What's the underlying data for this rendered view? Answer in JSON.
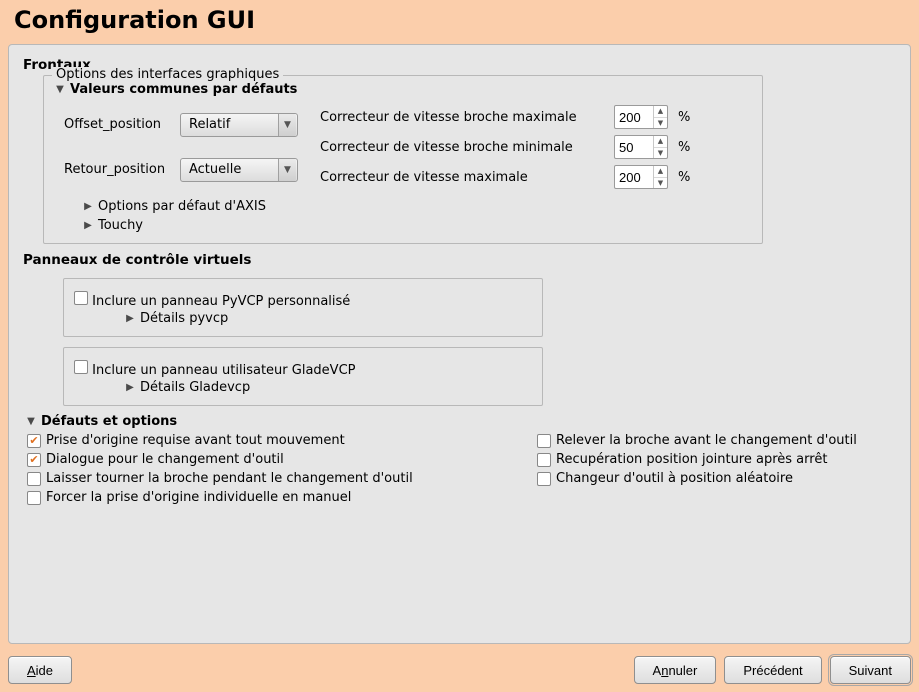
{
  "header": {
    "title": "Configuration GUI"
  },
  "frontaux": {
    "heading": "Frontaux",
    "gui_options": {
      "legend": "Options des interfaces graphiques",
      "common": {
        "title": "Valeurs communes par défauts",
        "offset_label": "Offset_position",
        "offset_value": "Relatif",
        "retour_label": "Retour_position",
        "retour_value": "Actuelle",
        "max_spindle_label": "Correcteur de vitesse broche maximale",
        "max_spindle_value": "200",
        "min_spindle_label": "Correcteur de vitesse broche minimale",
        "min_spindle_value": "50",
        "max_speed_label": "Correcteur de vitesse maximale",
        "max_speed_value": "200",
        "percent": "%"
      },
      "axis_defaults_label": "Options par défaut d'AXIS",
      "touchy_label": "Touchy"
    },
    "vcp": {
      "heading": "Panneaux de contrôle virtuels",
      "pyvcp_check_label": "Inclure un panneau PyVCP personnalisé",
      "pyvcp_details_label": "Détails pyvcp",
      "glade_check_label": "Inclure un panneau utilisateur GladeVCP",
      "glade_details_label": "Détails Gladevcp"
    }
  },
  "defaults": {
    "heading": "Défauts et options",
    "items": [
      {
        "label": "Prise d'origine requise avant tout mouvement",
        "checked": true
      },
      {
        "label": "Dialogue pour le changement d'outil",
        "checked": true
      },
      {
        "label": "Laisser tourner la broche pendant le changement d'outil",
        "checked": false
      },
      {
        "label": "Forcer la prise d'origine individuelle en manuel",
        "checked": false
      },
      {
        "label": "Relever la broche avant le changement d'outil",
        "checked": false
      },
      {
        "label": "Recupération position jointure après arrêt",
        "checked": false
      },
      {
        "label": "Changeur d'outil à position aléatoire",
        "checked": false
      }
    ]
  },
  "buttons": {
    "help": "Aide",
    "cancel": "Annuler",
    "back": "Précédent",
    "next": "Suivant"
  }
}
